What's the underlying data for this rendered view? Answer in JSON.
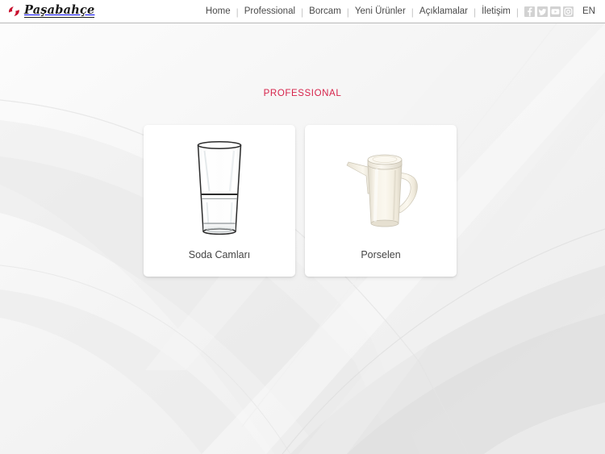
{
  "header": {
    "logo": {
      "name": "Paşabahçe",
      "mark_icon": "pasabahce-swoosh-icon",
      "mark_color": "#c8102e"
    },
    "nav_items": [
      {
        "label": "Home",
        "name": "home"
      },
      {
        "label": "Professional",
        "name": "professional"
      },
      {
        "label": "Borcam",
        "name": "borcam"
      },
      {
        "label": "Yeni Ürünler",
        "name": "yeni-urunler"
      },
      {
        "label": "Açıklamalar",
        "name": "aciklamalar"
      },
      {
        "label": "İletişim",
        "name": "iletisim"
      }
    ],
    "separator": "|",
    "social_icons": [
      {
        "name": "facebook-icon",
        "glyph": "f"
      },
      {
        "name": "twitter-icon",
        "glyph": "t"
      },
      {
        "name": "youtube-icon",
        "glyph": "y"
      },
      {
        "name": "instagram-icon",
        "glyph": "i"
      }
    ],
    "language": "EN",
    "nav_text_color": "#4a4a4a",
    "social_icon_color": "#d2d2d2"
  },
  "main": {
    "section_title": "PROFESSIONAL",
    "section_title_color": "#d6224a",
    "cards": [
      {
        "label": "Soda Camları",
        "name": "soda-camlari",
        "image_icon": "drinking-glass-tumbler-icon"
      },
      {
        "label": "Porselen",
        "name": "porselen",
        "image_icon": "porcelain-coffee-pot-icon"
      }
    ]
  },
  "background": {
    "base_color": "#f2f2f2",
    "swoosh_color": "#e6e6e6"
  }
}
